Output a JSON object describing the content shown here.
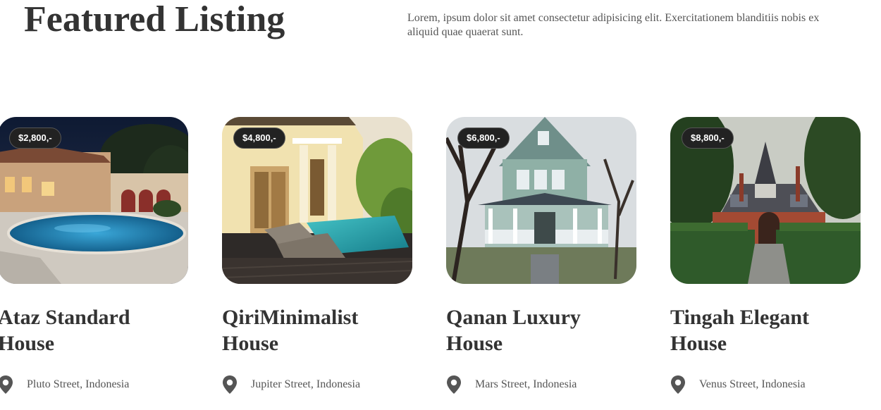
{
  "header": {
    "title": "Featured Listing",
    "intro": "Lorem, ipsum dolor sit amet consectetur adipisicing elit. Exercitationem blanditiis nobis ex aliquid quae quaerat sunt."
  },
  "listings": [
    {
      "price": "$2,800,-",
      "name": "Ataz Standard House",
      "address": "Pluto Street, Indonesia",
      "icon": "location-pin-icon"
    },
    {
      "price": "$4,800,-",
      "name": "QiriMinimalist House",
      "address": "Jupiter Street, Indonesia",
      "icon": "location-pin-icon"
    },
    {
      "price": "$6,800,-",
      "name": "Qanan Luxury House",
      "address": "Mars Street, Indonesia",
      "icon": "location-pin-icon"
    },
    {
      "price": "$8,800,-",
      "name": "Tingah Elegant House",
      "address": "Venus Street, Indonesia",
      "icon": "location-pin-icon"
    }
  ],
  "colors": {
    "heading": "#333333",
    "body_text": "#555555",
    "price_badge_bg": "#222222",
    "pin_icon": "#555555"
  }
}
